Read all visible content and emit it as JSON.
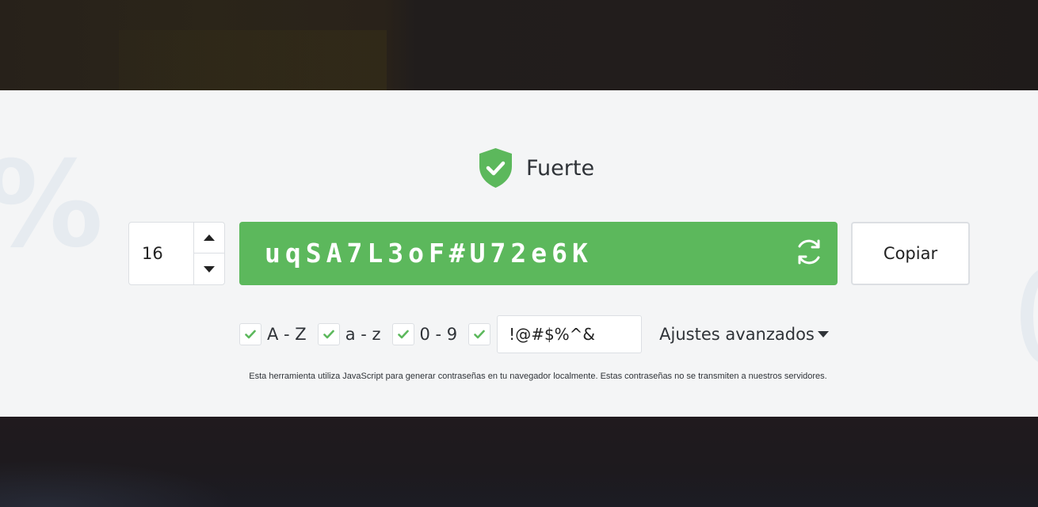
{
  "strength": {
    "label": "Fuerte",
    "color": "#5cb85c",
    "icon": "shield-check-icon"
  },
  "length": {
    "value": "16"
  },
  "password": {
    "value": "uqSA7L3oF#U72e6K",
    "background": "#5cb85c"
  },
  "copy_label": "Copiar",
  "options": [
    {
      "label": "A - Z",
      "checked": true
    },
    {
      "label": "a - z",
      "checked": true
    },
    {
      "label": "0 - 9",
      "checked": true
    },
    {
      "label": "",
      "checked": true
    }
  ],
  "symbols": {
    "value": "!@#$%^&"
  },
  "advanced_label": "Ajustes avanzados",
  "note": "Esta herramienta utiliza JavaScript para generar contraseñas en tu navegador localmente. Estas contraseñas no se transmiten a nuestros servidores."
}
